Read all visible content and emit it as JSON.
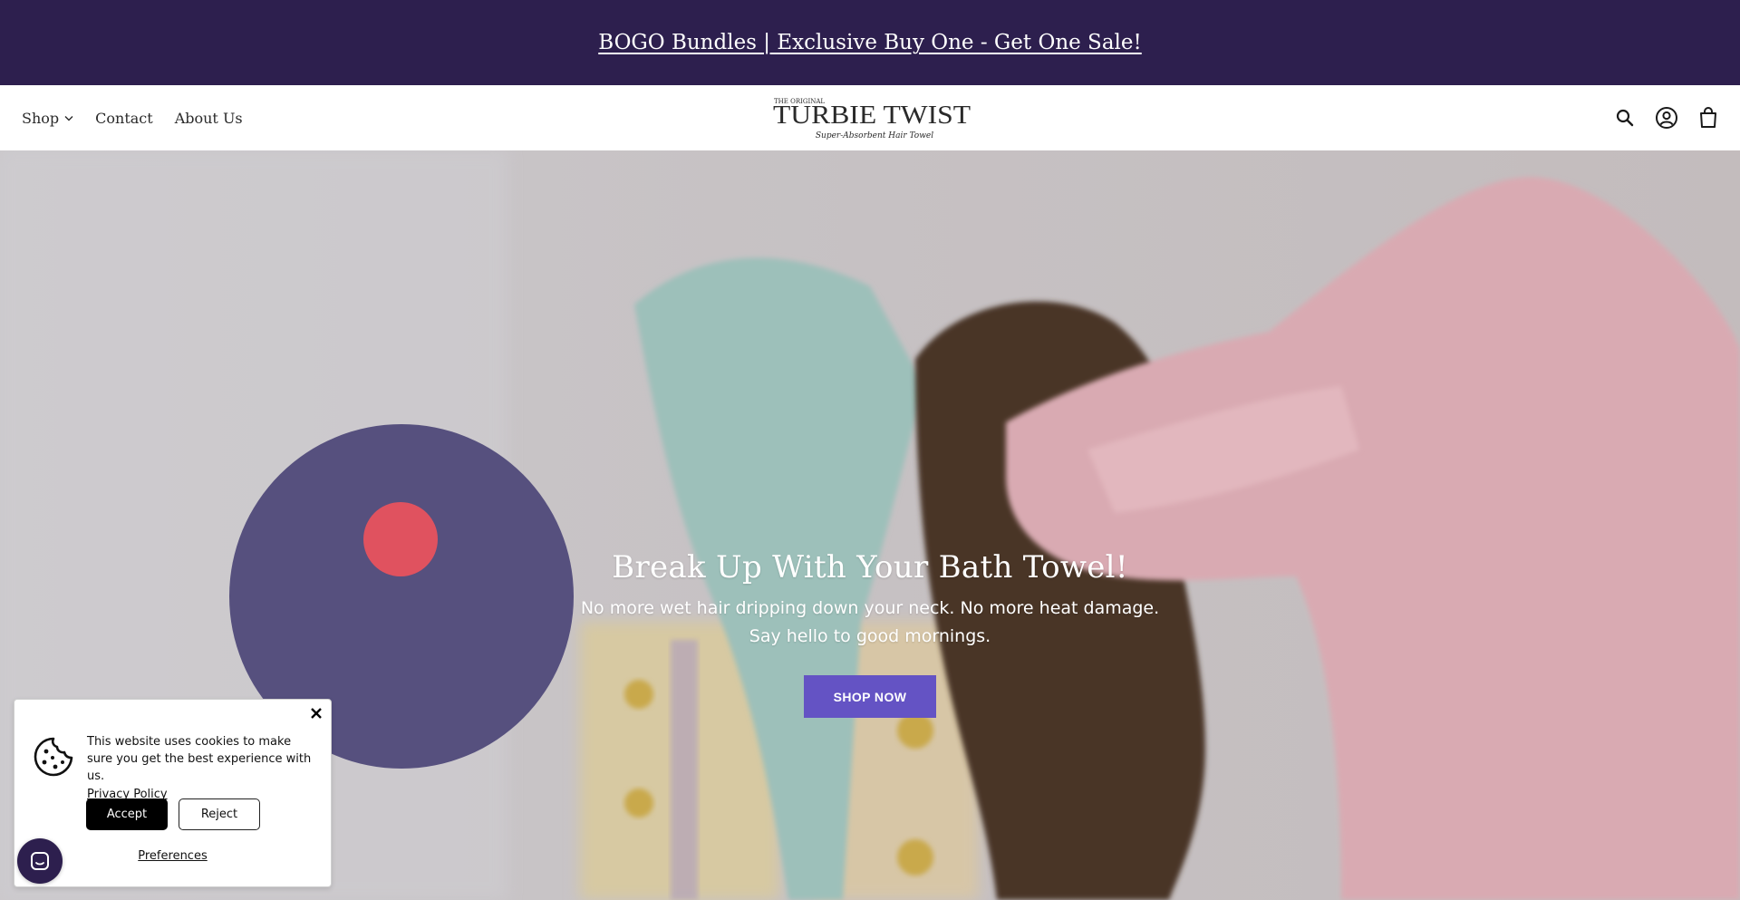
{
  "announcement": {
    "text": "BOGO Bundles | Exclusive Buy One - Get One Sale!"
  },
  "nav": {
    "shop": "Shop",
    "contact": "Contact",
    "about": "About Us"
  },
  "logo": {
    "top": "THE ORIGINAL",
    "brand": "TURBIE TWIST",
    "tagline": "Super-Absorbent Hair Towel"
  },
  "header_icons": [
    "search-icon",
    "account-icon",
    "cart-icon"
  ],
  "hero": {
    "title": "Break Up With Your Bath Towel!",
    "subtitle_line1": "No more wet hair dripping down your neck. No more heat damage.",
    "subtitle_line2": "Say hello to good mornings.",
    "cta": "SHOP NOW"
  },
  "cookie_banner": {
    "message": "This website uses cookies to make sure you get the best experience with us.",
    "privacy_link": "Privacy Policy",
    "accept": "Accept",
    "reject": "Reject",
    "preferences": "Preferences"
  },
  "colors": {
    "announcement_bg": "#2d1f4e",
    "accent": "#6453c4",
    "hero_overlay_circle": "#56507e",
    "hero_dot": "#e0525f"
  }
}
